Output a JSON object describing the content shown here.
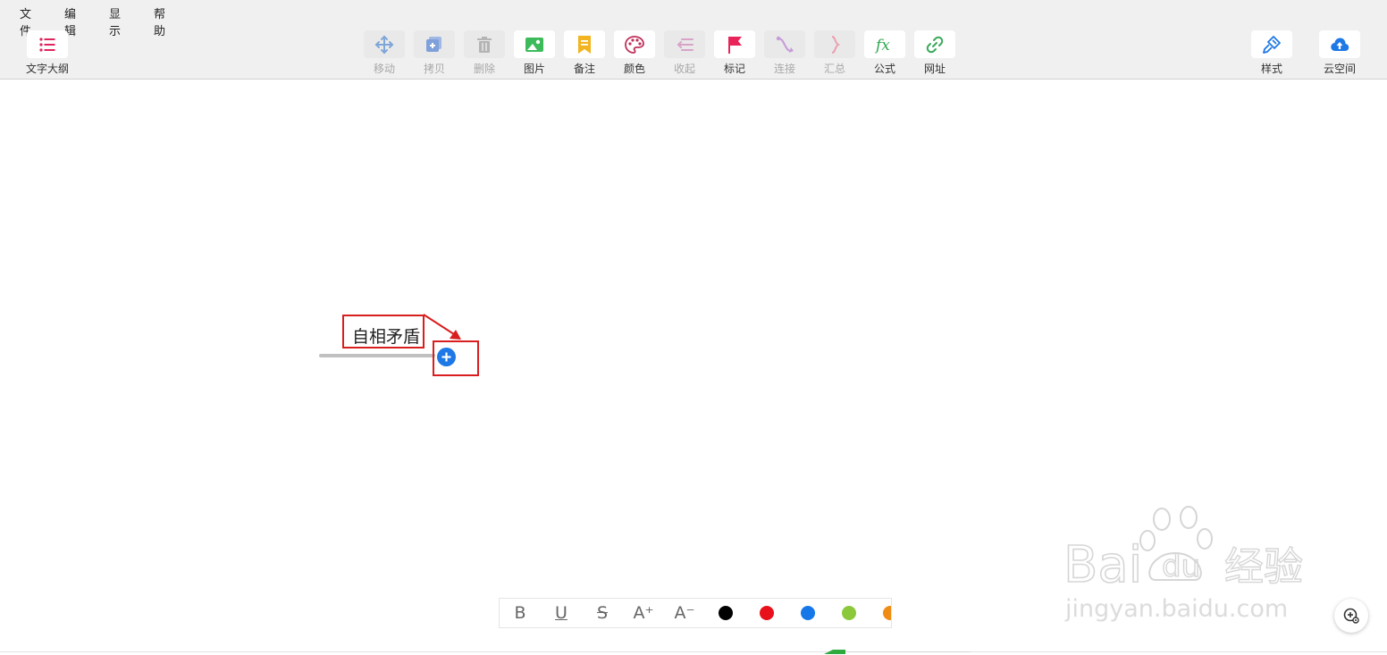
{
  "menubar": {
    "items": [
      {
        "label": "文件"
      },
      {
        "label": "编辑"
      },
      {
        "label": "显示"
      },
      {
        "label": "帮助"
      }
    ]
  },
  "toolbar": {
    "outline": {
      "label": "文字大纲",
      "icon": "list-icon",
      "color": "#e0245e"
    },
    "tools": [
      {
        "label": "移动",
        "icon": "move-icon",
        "enabled": false
      },
      {
        "label": "拷贝",
        "icon": "copy-icon",
        "enabled": false
      },
      {
        "label": "删除",
        "icon": "trash-icon",
        "enabled": false
      },
      {
        "label": "图片",
        "icon": "image-icon",
        "enabled": true
      },
      {
        "label": "备注",
        "icon": "note-icon",
        "enabled": true
      },
      {
        "label": "颜色",
        "icon": "palette-icon",
        "enabled": true
      },
      {
        "label": "收起",
        "icon": "collapse-icon",
        "enabled": false
      },
      {
        "label": "标记",
        "icon": "flag-icon",
        "enabled": true
      },
      {
        "label": "连接",
        "icon": "connect-icon",
        "enabled": false
      },
      {
        "label": "汇总",
        "icon": "summary-brace-icon",
        "enabled": false
      },
      {
        "label": "公式",
        "icon": "formula-fx-icon",
        "enabled": true
      },
      {
        "label": "网址",
        "icon": "link-icon",
        "enabled": true
      }
    ],
    "style": {
      "label": "样式",
      "icon": "brush-icon"
    },
    "cloud": {
      "label": "云空间",
      "icon": "cloud-upload-icon"
    }
  },
  "mindmap": {
    "topic_text": "自相矛盾",
    "add_child_icon": "plus-circle-icon"
  },
  "format_bar": {
    "bold": "B",
    "underline": "U",
    "strike": "S",
    "grow": "A⁺",
    "shrink": "A⁻",
    "colors": [
      "#000000",
      "#e8101a",
      "#1677e8",
      "#8cc83c",
      "#f08c14"
    ]
  },
  "watermark": {
    "logo_text": "Bai du 经验",
    "url_text": "jingyan.baidu.com"
  },
  "zoom_icon": "zoom-view-icon",
  "colors": {
    "annotation_red": "#d81e1e",
    "accent_blue": "#1e78e6"
  }
}
